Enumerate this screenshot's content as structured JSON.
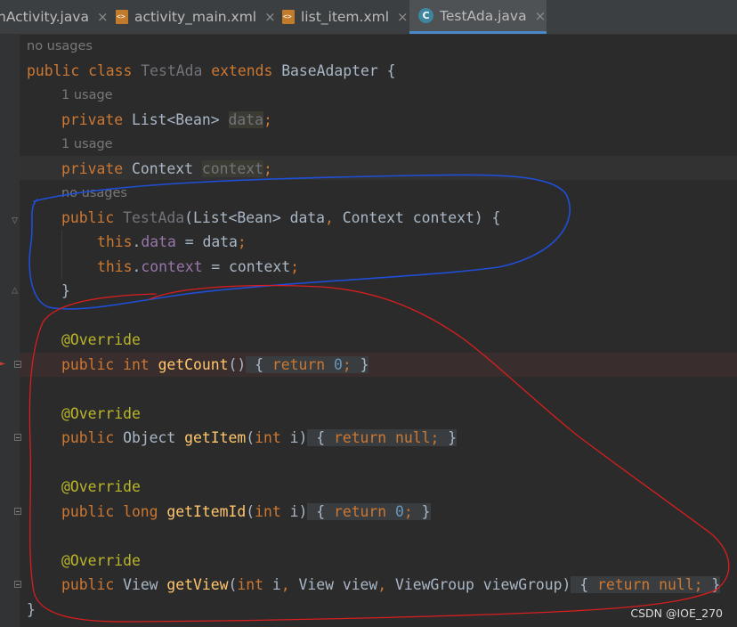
{
  "tabs": [
    {
      "label": "nActivity.java",
      "close": "×"
    },
    {
      "label": "activity_main.xml",
      "close": "×"
    },
    {
      "label": "list_item.xml",
      "close": "×"
    },
    {
      "label": "TestAda.java",
      "close": "×",
      "icon_letter": "C"
    }
  ],
  "hints": {
    "h1": "no usages",
    "h2": "1 usage",
    "h3": "1 usage",
    "h4": "no usages"
  },
  "code": {
    "l1": {
      "kw": "public class ",
      "name": "TestAda",
      "kw2": " extends ",
      "cls": "BaseAdapter",
      "rest": " {"
    },
    "l2": {
      "kw": "private ",
      "type": "List<Bean> ",
      "field": "data",
      "semi": ";"
    },
    "l3": {
      "kw": "private ",
      "type": "Context ",
      "field": "context",
      "semi": ";"
    },
    "l4": {
      "kw": "public ",
      "name": "TestAda",
      "p1": "(List<Bean> data",
      "comma": ", ",
      "p2": "Context context) {"
    },
    "l5": {
      "this": "this",
      "dot": ".",
      "field": "data",
      "rest": " = data",
      "semi": ";"
    },
    "l6": {
      "this": "this",
      "dot": ".",
      "field": "context",
      "rest": " = context",
      "semi": ";"
    },
    "l7": {
      "text": "}"
    },
    "a1": "@Override",
    "m1": {
      "kw": "public int ",
      "fn": "getCount",
      "par": "()",
      "b1": " { ",
      "ret": "return ",
      "num": "0",
      "semi": "; ",
      "b2": "}"
    },
    "a2": "@Override",
    "m2": {
      "kw": "public ",
      "type": "Object ",
      "fn": "getItem",
      "p": "(",
      "kw2": "int ",
      "arg": "i)",
      "b1": " { ",
      "ret": "return null",
      "semi": "; ",
      "b2": "}"
    },
    "a3": "@Override",
    "m3": {
      "kw": "public long ",
      "fn": "getItemId",
      "p": "(",
      "kw2": "int ",
      "arg": "i)",
      "b1": " { ",
      "ret": "return ",
      "num": "0",
      "semi": "; ",
      "b2": "}"
    },
    "a4": "@Override",
    "m4": {
      "kw": "public ",
      "type": "View ",
      "fn": "getView",
      "p": "(",
      "kw2": "int ",
      "a1": "i",
      "c1": ", ",
      "a2": "View view",
      "c2": ", ",
      "a3": "ViewGroup viewGroup)",
      "b1": " { ",
      "ret": "return null",
      "semi": "; ",
      "b2": "}"
    },
    "end": "}"
  },
  "watermark": "CSDN @IOE_270",
  "colors": {
    "keyword": "#cc7832",
    "function": "#ffc66d",
    "annotation": "#bbb529",
    "number": "#6897bb",
    "field": "#9876aa",
    "blue_ink": "#1f4fd6",
    "red_ink": "#d81e1e"
  }
}
